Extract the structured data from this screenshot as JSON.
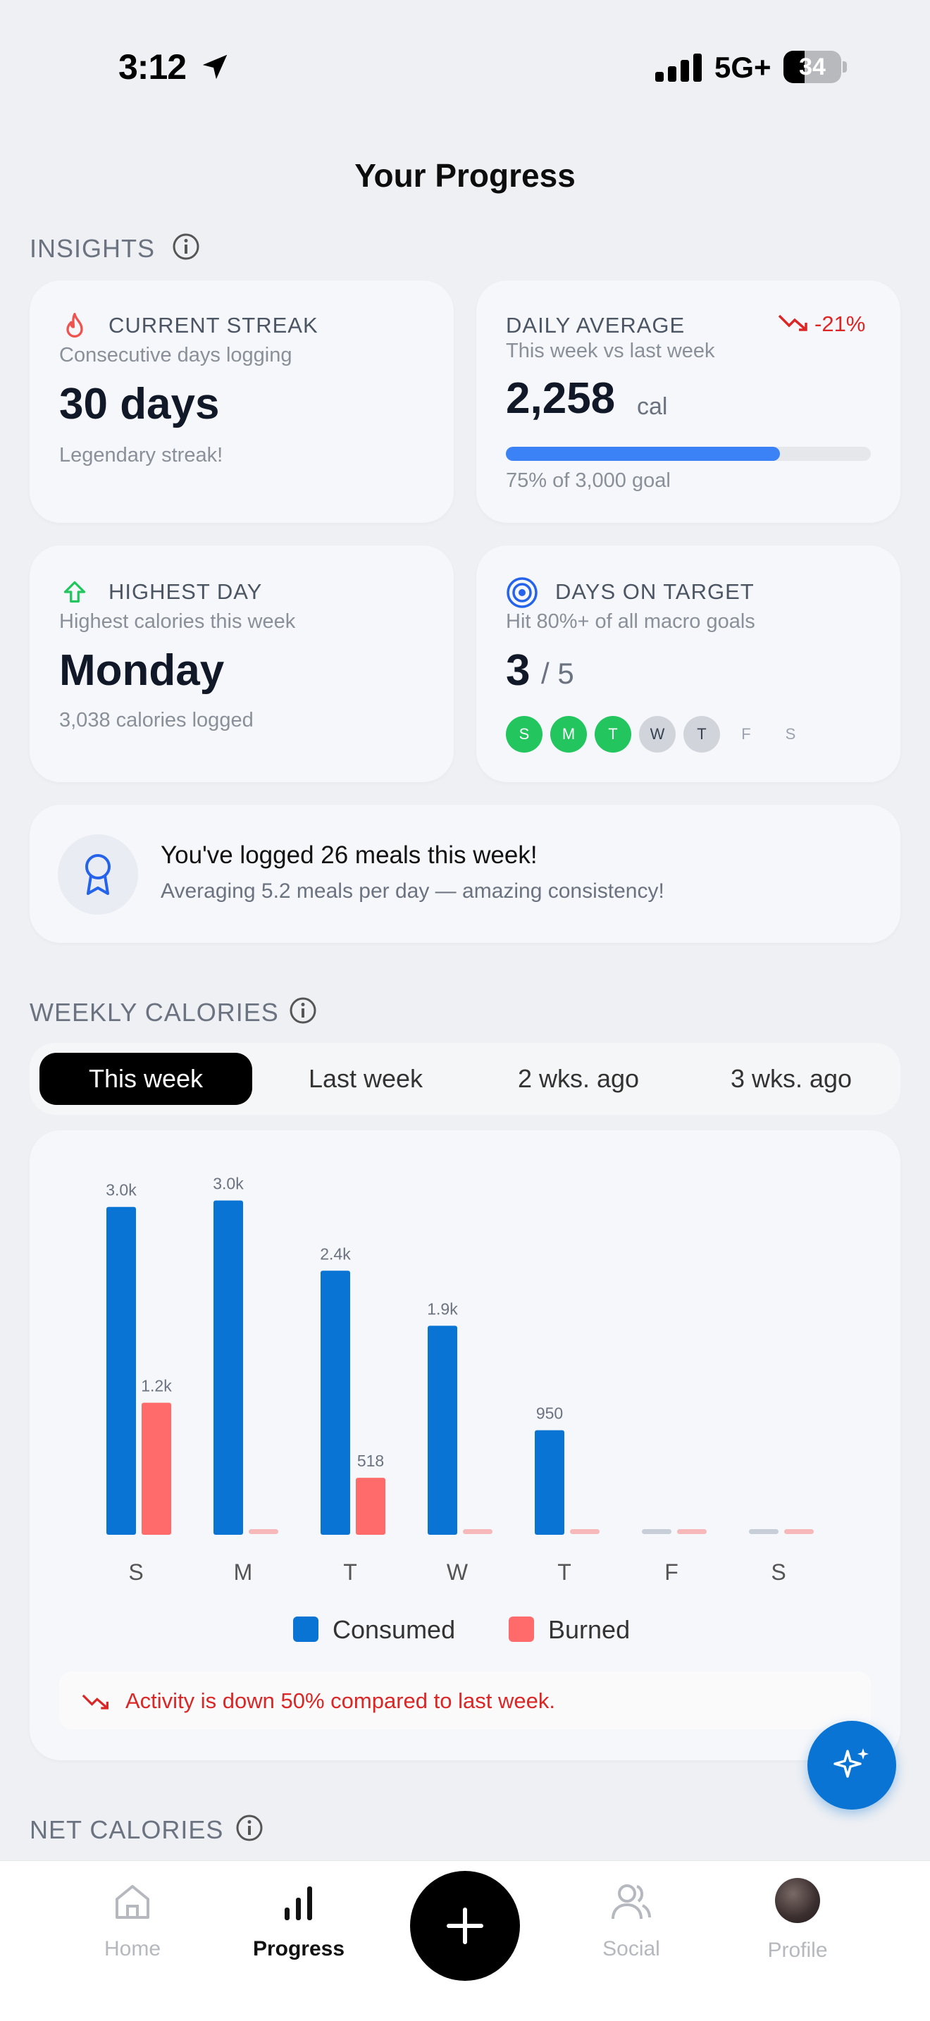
{
  "status_bar": {
    "time": "3:12",
    "network": "5G+",
    "battery": "34"
  },
  "page_title": "Your Progress",
  "insights": {
    "label": "INSIGHTS",
    "streak": {
      "title": "CURRENT STREAK",
      "subtitle": "Consecutive days logging",
      "value": "30 days",
      "footer": "Legendary streak!"
    },
    "daily_average": {
      "title": "DAILY AVERAGE",
      "change": "-21%",
      "subtitle": "This week vs last week",
      "value": "2,258",
      "unit": "cal",
      "progress": 0.75,
      "footer": "75% of 3,000 goal"
    },
    "highest_day": {
      "title": "HIGHEST DAY",
      "subtitle": "Highest calories this week",
      "value": "Monday",
      "footer": "3,038 calories logged"
    },
    "days_on_target": {
      "title": "DAYS ON TARGET",
      "subtitle": "Hit 80%+ of all macro goals",
      "value": "3",
      "total": "/ 5",
      "days": [
        {
          "label": "S",
          "state": "hit"
        },
        {
          "label": "M",
          "state": "hit"
        },
        {
          "label": "T",
          "state": "hit"
        },
        {
          "label": "W",
          "state": "miss"
        },
        {
          "label": "T",
          "state": "miss"
        },
        {
          "label": "F",
          "state": "future"
        },
        {
          "label": "S",
          "state": "future"
        }
      ]
    },
    "meals_banner": {
      "title": "You've logged 26 meals this week!",
      "subtitle": "Averaging 5.2 meals per day — amazing consistency!"
    }
  },
  "weekly_calories": {
    "label": "WEEKLY CALORIES",
    "tabs": [
      "This week",
      "Last week",
      "2 wks. ago",
      "3 wks. ago"
    ],
    "active_tab": "This week",
    "legend": {
      "consumed": "Consumed",
      "burned": "Burned"
    },
    "alert": "Activity is down 50% compared to last week."
  },
  "chart_data": {
    "type": "bar",
    "categories": [
      "S",
      "M",
      "T",
      "W",
      "T",
      "F",
      "S"
    ],
    "series": [
      {
        "name": "Consumed",
        "values": [
          2980,
          3038,
          2400,
          1900,
          950,
          0,
          0
        ],
        "labels": [
          "3.0k",
          "3.0k",
          "2.4k",
          "1.9k",
          "950",
          "",
          ""
        ],
        "color": "#0a74d4"
      },
      {
        "name": "Burned",
        "values": [
          1200,
          0,
          518,
          0,
          0,
          0,
          0
        ],
        "labels": [
          "1.2k",
          "",
          "518",
          "",
          "",
          "",
          ""
        ],
        "color": "#ff6b6b"
      }
    ],
    "ylim": [
      0,
      3100
    ]
  },
  "net_calories": {
    "label": "NET CALORIES"
  },
  "nav": {
    "home": "Home",
    "progress": "Progress",
    "social": "Social",
    "profile": "Profile"
  },
  "colors": {
    "accent": "#0a74d4",
    "burned": "#ff6b6b",
    "success": "#22c55e",
    "danger": "#dc2626"
  }
}
